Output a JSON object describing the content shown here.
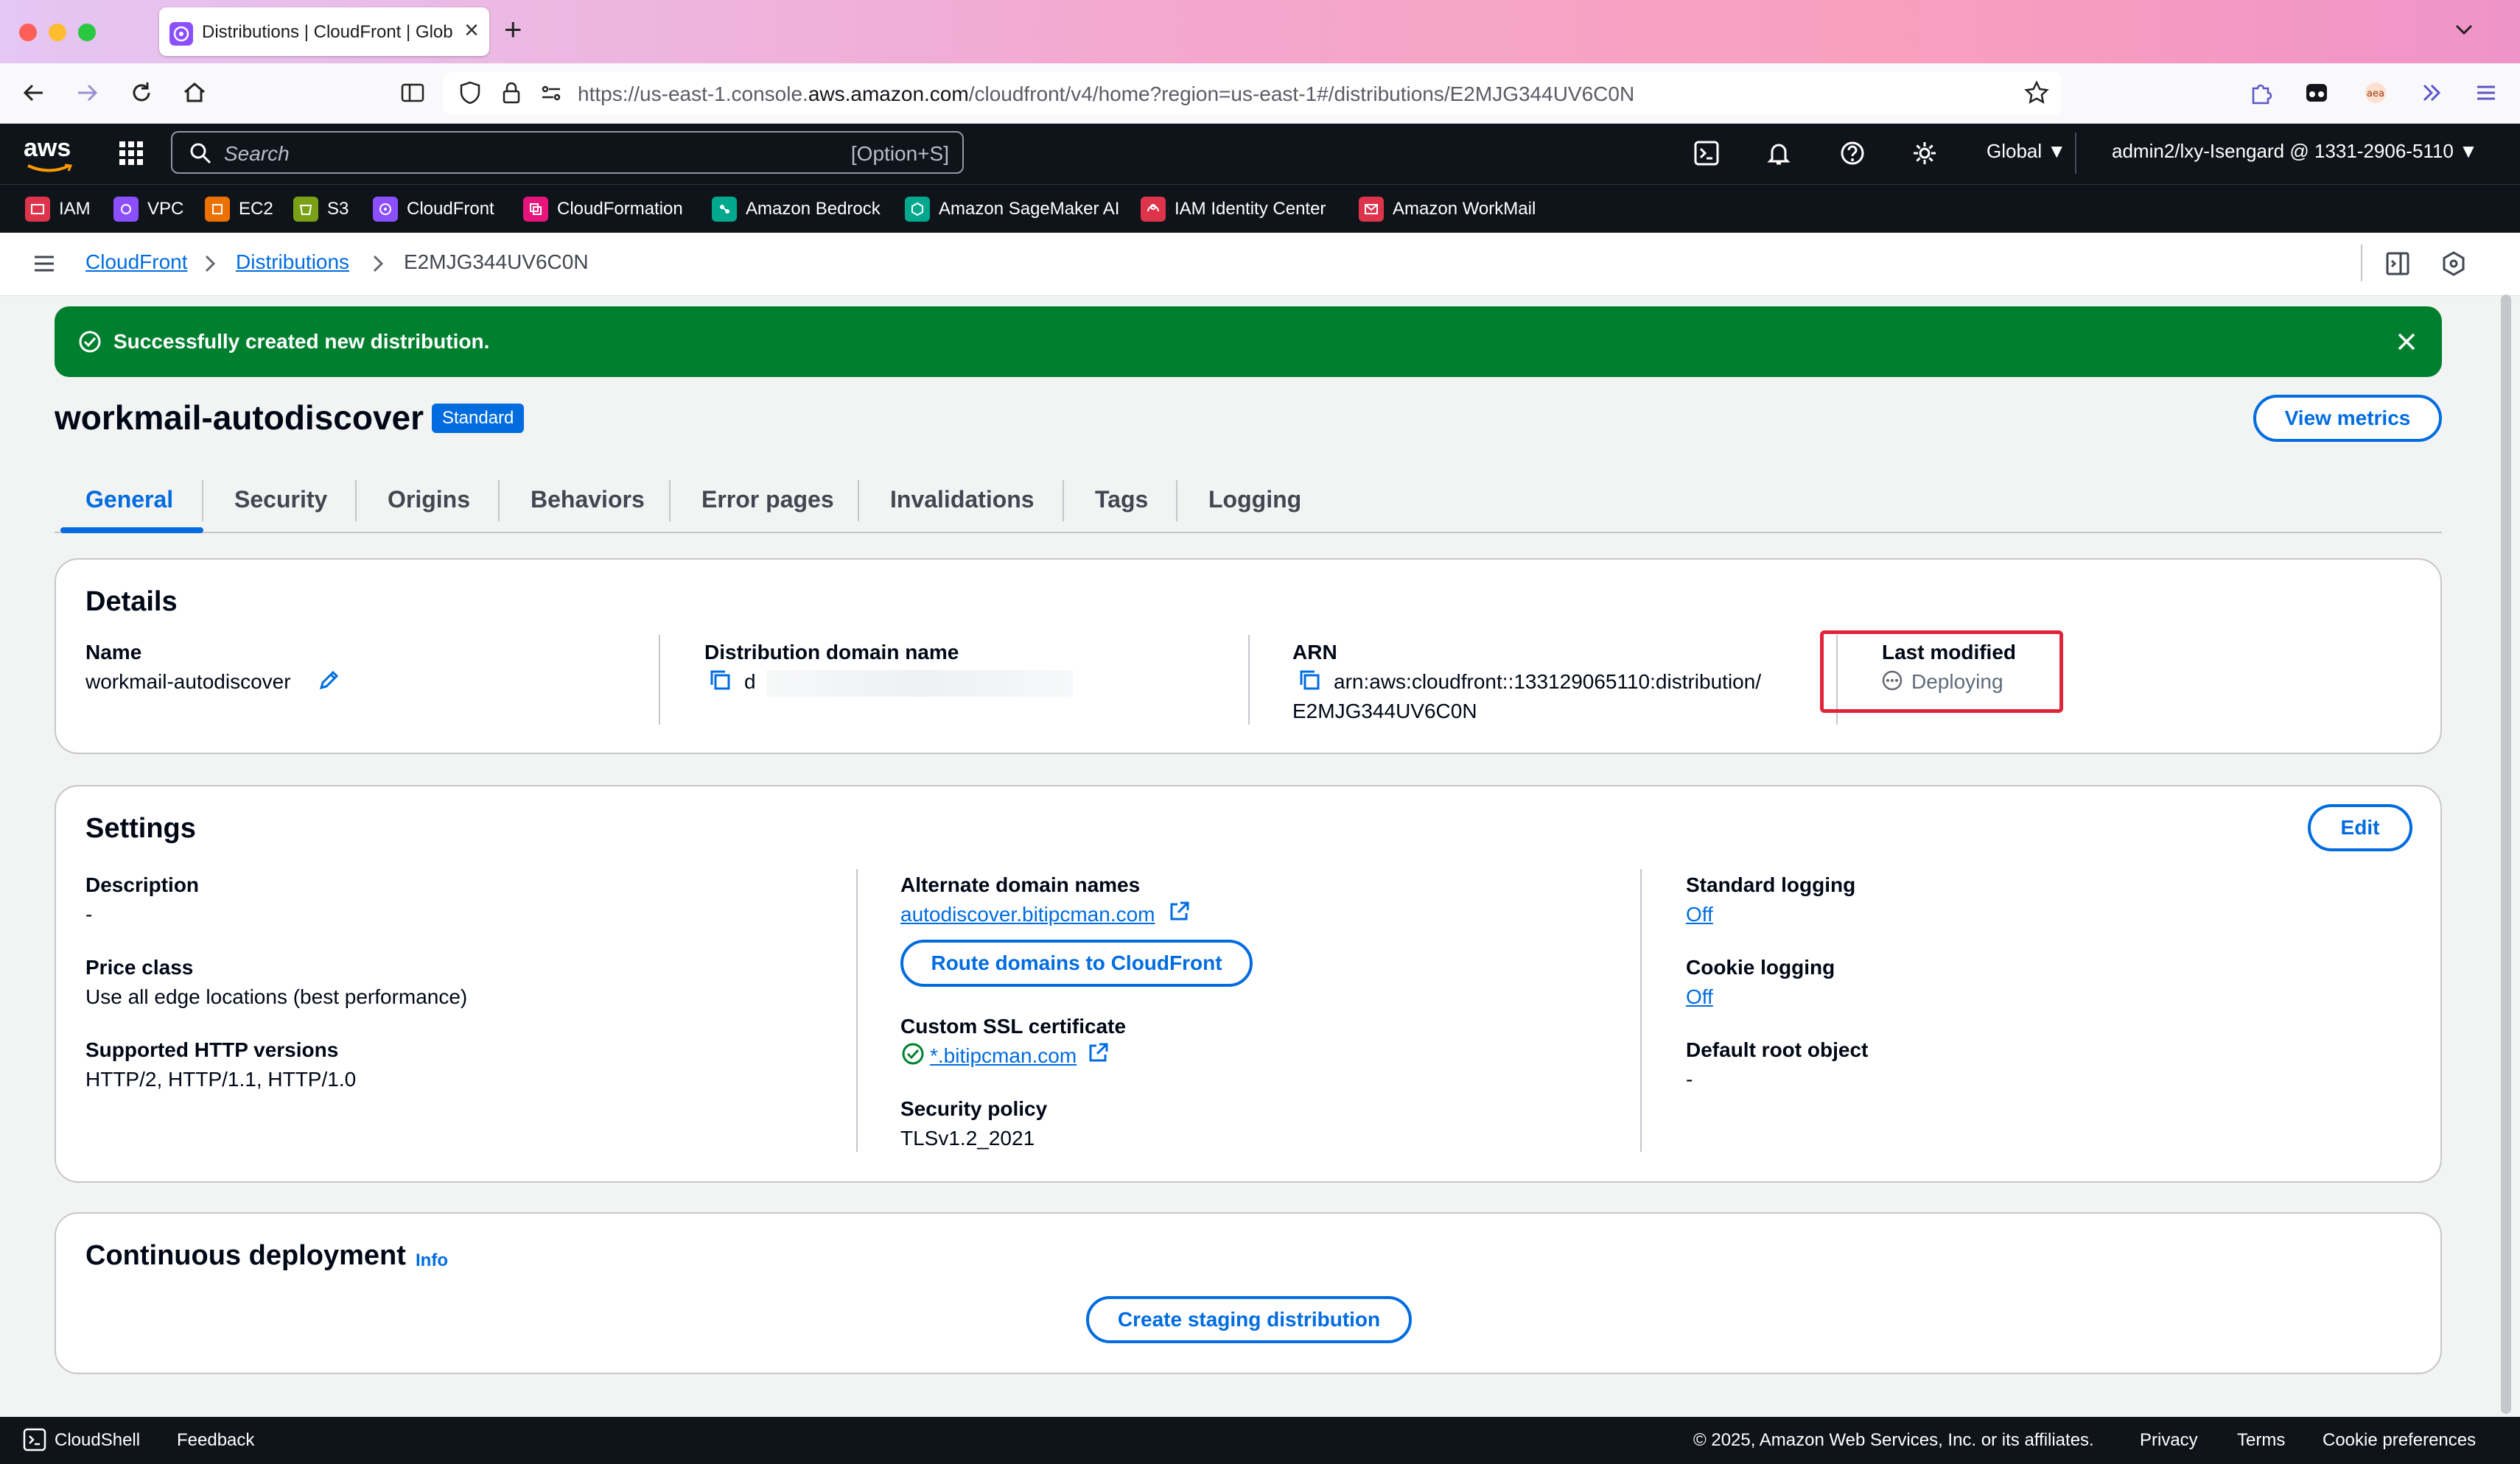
{
  "browser": {
    "tab_title": "Distributions | CloudFront | Glob",
    "url_prefix": "https://us-east-1.console.",
    "url_domain": "aws.amazon.com",
    "url_path": "/cloudfront/v4/home?region=us-east-1#/distributions/E2MJG344UV6C0N"
  },
  "aws_header": {
    "logo": "aws",
    "search_placeholder": "Search",
    "search_shortcut": "[Option+S]",
    "region": "Global",
    "account": "admin2/lxy-Isengard @ 1331-2906-5110"
  },
  "favorites": [
    {
      "label": "IAM",
      "color": "#dd344c"
    },
    {
      "label": "VPC",
      "color": "#8c4fff"
    },
    {
      "label": "EC2",
      "color": "#ed7100"
    },
    {
      "label": "S3",
      "color": "#7aa116"
    },
    {
      "label": "CloudFront",
      "color": "#8c4fff"
    },
    {
      "label": "CloudFormation",
      "color": "#e7157b"
    },
    {
      "label": "Amazon Bedrock",
      "color": "#01a88d"
    },
    {
      "label": "Amazon SageMaker AI",
      "color": "#01a88d"
    },
    {
      "label": "IAM Identity Center",
      "color": "#dd344c"
    },
    {
      "label": "Amazon WorkMail",
      "color": "#dd344c"
    }
  ],
  "breadcrumbs": [
    "CloudFront",
    "Distributions",
    "E2MJG344UV6C0N"
  ],
  "flash": {
    "message": "Successfully created new distribution."
  },
  "page": {
    "title": "workmail-autodiscover",
    "badge": "Standard",
    "view_metrics": "View metrics"
  },
  "tabs": [
    "General",
    "Security",
    "Origins",
    "Behaviors",
    "Error pages",
    "Invalidations",
    "Tags",
    "Logging"
  ],
  "details": {
    "heading": "Details",
    "name_label": "Name",
    "name_value": "workmail-autodiscover",
    "domain_label": "Distribution domain name",
    "domain_value": "d",
    "arn_label": "ARN",
    "arn_line1": "arn:aws:cloudfront::133129065110:distribution/",
    "arn_line2": "E2MJG344UV6C0N",
    "modified_label": "Last modified",
    "modified_value": "Deploying"
  },
  "settings": {
    "heading": "Settings",
    "edit": "Edit",
    "description_label": "Description",
    "description_value": "-",
    "price_label": "Price class",
    "price_value": "Use all edge locations (best performance)",
    "http_label": "Supported HTTP versions",
    "http_value": "HTTP/2, HTTP/1.1, HTTP/1.0",
    "alt_label": "Alternate domain names",
    "alt_value": "autodiscover.bitipcman.com",
    "route_button": "Route domains to CloudFront",
    "ssl_label": "Custom SSL certificate",
    "ssl_value": "*.bitipcman.com",
    "policy_label": "Security policy",
    "policy_value": "TLSv1.2_2021",
    "stdlog_label": "Standard logging",
    "stdlog_value": "Off",
    "cookie_label": "Cookie logging",
    "cookie_value": "Off",
    "root_label": "Default root object",
    "root_value": "-"
  },
  "continuous": {
    "heading": "Continuous deployment",
    "info": "Info",
    "button": "Create staging distribution"
  },
  "footer": {
    "cloudshell": "CloudShell",
    "feedback": "Feedback",
    "copyright": "© 2025, Amazon Web Services, Inc. or its affiliates.",
    "privacy": "Privacy",
    "terms": "Terms",
    "cookies": "Cookie preferences"
  },
  "colors": {
    "accent": "#006ce0",
    "success": "#00802f",
    "header_bg": "#0f141a",
    "highlight": "#e0253a"
  }
}
